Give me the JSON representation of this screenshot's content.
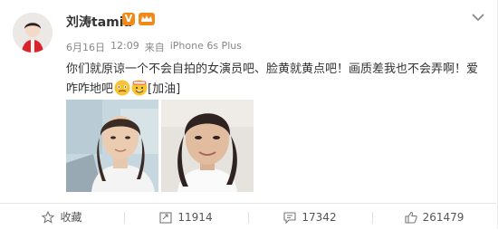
{
  "post": {
    "author": "刘涛tamia",
    "verified_badge": "V",
    "date": "6月16日",
    "time": "12:09",
    "source_prefix": "来自",
    "source_device": "iPhone 6s Plus",
    "text_line1": "你们就原谅一个不会自拍的女演员吧、脸黄就黄点吧！画质差我也不会弄啊！爱",
    "text_line2_prefix": "咋咋地吧",
    "emoji_tag": "[加油]",
    "photos": [
      {
        "icon": "photo-selfie-1"
      },
      {
        "icon": "photo-selfie-2"
      }
    ]
  },
  "actions": {
    "favorite_label": "收藏",
    "repost_count": "11914",
    "comment_count": "17342",
    "like_count": "261479"
  },
  "colors": {
    "accent_orange": "#f28a1a",
    "meta_gray": "#888888",
    "text": "#333333",
    "divider": "#e6e6e6"
  }
}
